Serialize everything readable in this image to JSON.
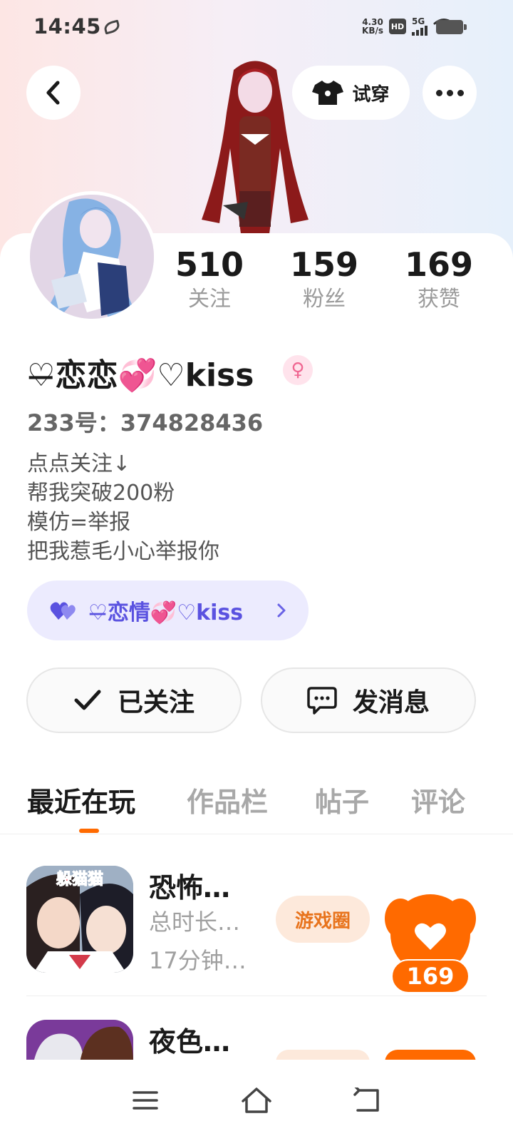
{
  "status_bar": {
    "time": "14:45",
    "net_speed_value": "4.30",
    "net_speed_unit": "KB/s",
    "hd": "HD",
    "network": "5G"
  },
  "header": {
    "tryon_label": "试穿"
  },
  "profile": {
    "nickname_prefix": "♡̶恋恋",
    "nickname_heart": "💞",
    "nickname_suffix": "♡kiss",
    "gender_symbol": "♀",
    "uid": "233号：374828436",
    "bio": [
      "点点关注↓",
      "帮我突破200粉",
      "模仿=举报",
      "把我惹毛小心举报你"
    ]
  },
  "stats": [
    {
      "value": "510",
      "label": "关注"
    },
    {
      "value": "159",
      "label": "粉丝"
    },
    {
      "value": "169",
      "label": "获赞"
    }
  ],
  "group_chip": {
    "label": "♡̶恋情💞♡kiss"
  },
  "actions": {
    "follow_label": "已关注",
    "message_label": "发消息"
  },
  "tabs": [
    "最近在玩",
    "作品栏",
    "帖子",
    "评论"
  ],
  "games": [
    {
      "title": "恐怖…",
      "meta1": "总时长…",
      "meta2": "17分钟…",
      "circle_label": "游戏圈",
      "icon_badge": "躲猫猫"
    },
    {
      "title": "夜色…"
    }
  ],
  "like_bubble": {
    "count": "169"
  },
  "colors": {
    "accent_orange": "#ff6a00",
    "group_purple": "#5a52e0",
    "gender_pink": "#f06792"
  }
}
